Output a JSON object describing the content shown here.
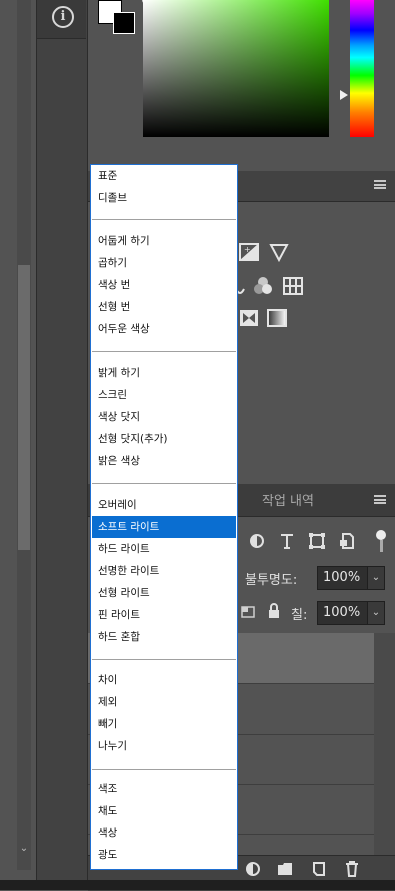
{
  "tool_column": {
    "info_icon_glyph": "i"
  },
  "color_panel": {
    "foreground": "#ffffff",
    "background": "#000000",
    "picker_hue": "#3fdf00"
  },
  "adjustments": {
    "menu_icon": "panel-menu-icon",
    "icons": [
      "exposure-icon",
      "triangle-gradient-icon",
      "channel-mixer-icon",
      "color-lookup-icon",
      "invert-icon",
      "gradient-map-icon"
    ]
  },
  "layers_panel": {
    "tabs": {
      "history": "작업 내역"
    },
    "opacity_label": "불투명도:",
    "opacity_value": "100%",
    "fill_label": "칠:",
    "fill_value": "100%",
    "filter_icons": [
      "adjustment-filter-icon",
      "type-filter-icon",
      "shape-filter-icon",
      "smart-object-filter-icon"
    ],
    "bottom_icons": [
      "adjustment-layer-icon",
      "folder-icon",
      "new-layer-icon",
      "trash-icon"
    ]
  },
  "blend_menu": {
    "groups": [
      [
        "표준",
        "디졸브"
      ],
      [
        "어둡게 하기",
        "곱하기",
        "색상 번",
        "선형 번",
        "어두운 색상"
      ],
      [
        "밝게 하기",
        "스크린",
        "색상 닷지",
        "선형 닷지(추가)",
        "밝은 색상"
      ],
      [
        "오버레이",
        "소프트 라이트",
        "하드 라이트",
        "선명한 라이트",
        "선형 라이트",
        "핀 라이트",
        "하드 혼합"
      ],
      [
        "차이",
        "제외",
        "빼기",
        "나누기"
      ],
      [
        "색조",
        "채도",
        "색상",
        "광도"
      ]
    ],
    "selected": "소프트 라이트"
  }
}
